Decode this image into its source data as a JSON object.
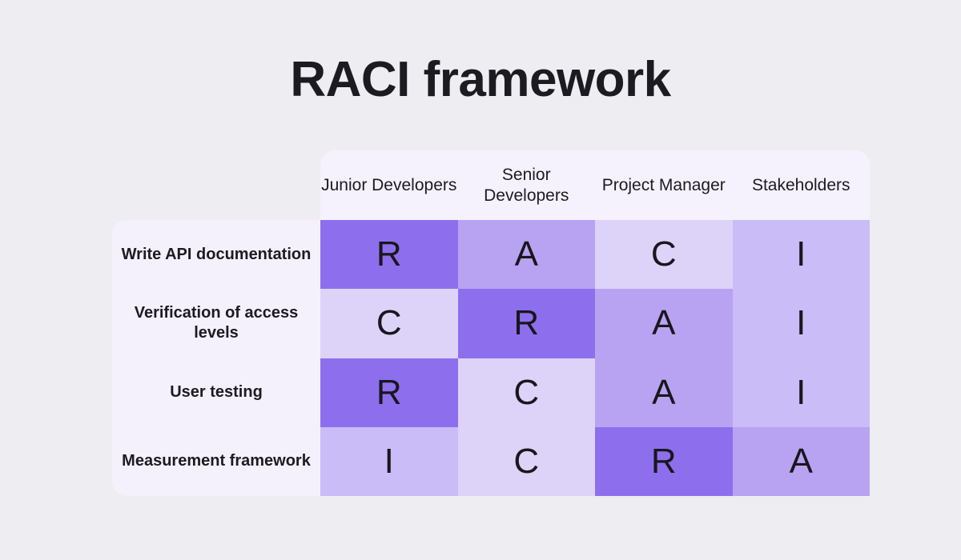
{
  "page": {
    "title": "RACI framework",
    "background_color": "#eeedf2",
    "text_color": "#1c1b22"
  },
  "legend_colors": {
    "R": "#8d6fed",
    "A": "#b8a3f2",
    "I": "#c9bcf7",
    "C": "#ddd3f8",
    "grid_line": "#16151b",
    "header_background": "#f5f2fd",
    "row_label_background": "#f4f1fc"
  },
  "chart_data": {
    "type": "table",
    "title": "RACI framework",
    "corner_label": "",
    "categories": [
      "Junior Developers",
      "Senior Developers",
      "Project Manager",
      "Stakeholders"
    ],
    "rows": [
      {
        "label": "Write API documentation",
        "values": [
          "R",
          "A",
          "C",
          "I"
        ]
      },
      {
        "label": "Verification of access levels",
        "values": [
          "C",
          "R",
          "A",
          "I"
        ]
      },
      {
        "label": "User testing",
        "values": [
          "R",
          "C",
          "A",
          "I"
        ]
      },
      {
        "label": "Measurement framework",
        "values": [
          "I",
          "C",
          "R",
          "A"
        ]
      }
    ]
  },
  "headers": {
    "col0": "Junior Developers",
    "col1": "Senior Developers",
    "col2": "Project Manager",
    "col3": "Stakeholders"
  },
  "row_labels": {
    "r0": "Write API documentation",
    "r1": "Verification of access levels",
    "r2": "User testing",
    "r3": "Measurement framework"
  },
  "cells": {
    "r0": {
      "c0": "R",
      "c1": "A",
      "c2": "C",
      "c3": "I"
    },
    "r1": {
      "c0": "C",
      "c1": "R",
      "c2": "A",
      "c3": "I"
    },
    "r2": {
      "c0": "R",
      "c1": "C",
      "c2": "A",
      "c3": "I"
    },
    "r3": {
      "c0": "I",
      "c1": "C",
      "c2": "R",
      "c3": "A"
    }
  }
}
